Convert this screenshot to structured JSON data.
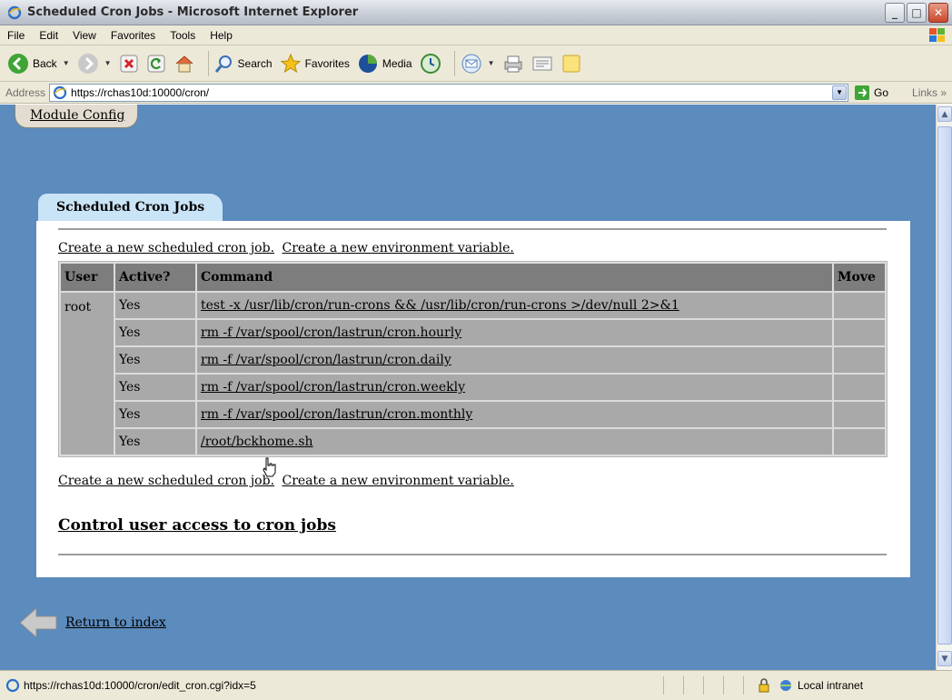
{
  "window": {
    "title": "Scheduled Cron Jobs - Microsoft Internet Explorer"
  },
  "menu": [
    "File",
    "Edit",
    "View",
    "Favorites",
    "Tools",
    "Help"
  ],
  "toolbar": {
    "back": "Back",
    "search": "Search",
    "favorites": "Favorites",
    "media": "Media"
  },
  "address": {
    "label": "Address",
    "url": "https://rchas10d:10000/cron/",
    "go": "Go",
    "links": "Links"
  },
  "module_config": "Module Config",
  "section_title": "Scheduled Cron Jobs",
  "links": {
    "create_job": "Create a new scheduled cron job.",
    "create_env": "Create a new environment variable."
  },
  "table": {
    "headers": {
      "user": "User",
      "active": "Active?",
      "command": "Command",
      "move": "Move"
    },
    "user": "root",
    "rows": [
      {
        "active": "Yes",
        "command": "test -x /usr/lib/cron/run-crons && /usr/lib/cron/run-crons >/dev/null 2>&1"
      },
      {
        "active": "Yes",
        "command": "rm -f /var/spool/cron/lastrun/cron.hourly"
      },
      {
        "active": "Yes",
        "command": "rm -f /var/spool/cron/lastrun/cron.daily"
      },
      {
        "active": "Yes",
        "command": "rm -f /var/spool/cron/lastrun/cron.weekly"
      },
      {
        "active": "Yes",
        "command": "rm -f /var/spool/cron/lastrun/cron.monthly"
      },
      {
        "active": "Yes",
        "command": "/root/bckhome.sh"
      }
    ]
  },
  "control_access": "Control user access to cron jobs",
  "return_index": "Return to index",
  "status": {
    "text": "https://rchas10d:10000/cron/edit_cron.cgi?idx=5",
    "zone": "Local intranet"
  }
}
